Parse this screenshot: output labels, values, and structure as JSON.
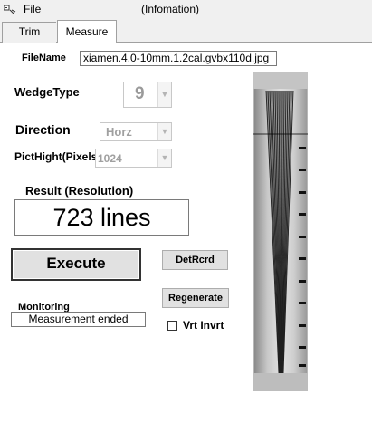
{
  "titlebar": {
    "menu_file": "File",
    "title": "(Infomation)"
  },
  "tabs": [
    {
      "label": "Trim",
      "active": false
    },
    {
      "label": "Measure",
      "active": true
    }
  ],
  "form": {
    "filename_label": "FileName",
    "filename_value": "xiamen.4.0-10mm.1.2cal.gvbx110d.jpg",
    "wedgetype_label": "WedgeType",
    "wedgetype_value": "9",
    "direction_label": "Direction",
    "direction_value": "Horz",
    "pictheight_label": "PictHight(Pixels)",
    "pictheight_value": "1024",
    "result_label": "Result (Resolution)",
    "result_value": "723 lines",
    "monitoring_label": "Monitoring",
    "monitoring_value": "Measurement ended",
    "vrt_invrt_label": "Vrt Invrt",
    "vrt_invrt_checked": false
  },
  "buttons": {
    "execute": "Execute",
    "detrcrd": "DetRcrd",
    "regenerate": "Regenerate"
  },
  "icons": {
    "app": "app-icon",
    "dropdown": "chevron-down-icon"
  }
}
